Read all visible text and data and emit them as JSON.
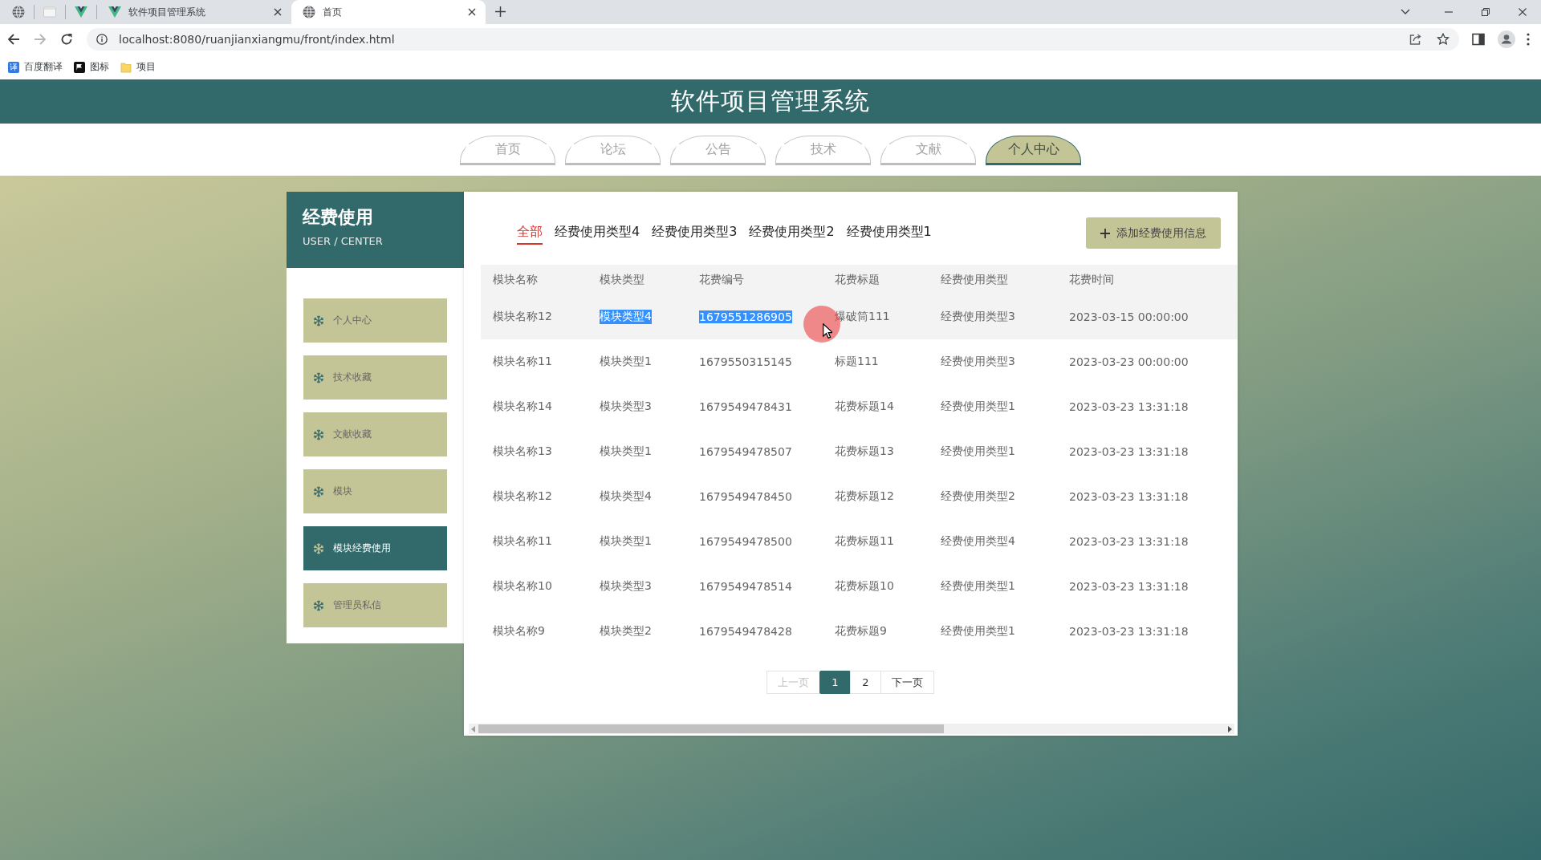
{
  "browser": {
    "tabs": [
      {
        "kind": "globe",
        "selected": false
      },
      {
        "kind": "page",
        "selected": false
      },
      {
        "kind": "v-logo",
        "selected": false
      },
      {
        "kind": "v-logo",
        "title": "软件项目管理系统",
        "selected": false
      },
      {
        "kind": "globe",
        "title": "首页",
        "selected": true
      }
    ],
    "address_bar": {
      "url": "localhost:8080/ruanjianxiangmu/front/index.html",
      "forward_enabled": false
    },
    "bookmarks": [
      {
        "kind": "translate",
        "badge": "译",
        "label": "百度翻译"
      },
      {
        "kind": "flag",
        "label": "图标"
      },
      {
        "kind": "folder",
        "label": "项目"
      }
    ]
  },
  "site_title": "软件项目管理系统",
  "nav": [
    {
      "label": "首页",
      "selected": false
    },
    {
      "label": "论坛",
      "selected": false
    },
    {
      "label": "公告",
      "selected": false
    },
    {
      "label": "技术",
      "selected": false
    },
    {
      "label": "文献",
      "selected": false
    },
    {
      "label": "个人中心",
      "selected": true
    }
  ],
  "sidebar": {
    "title": "经费使用",
    "subtitle": "USER / CENTER",
    "items": [
      {
        "label": "个人中心",
        "selected": false
      },
      {
        "label": "技术收藏",
        "selected": false
      },
      {
        "label": "文献收藏",
        "selected": false
      },
      {
        "label": "模块",
        "selected": false
      },
      {
        "label": "模块经费使用",
        "selected": true
      },
      {
        "label": "管理员私信",
        "selected": false
      }
    ]
  },
  "filters": [
    {
      "label": "全部",
      "selected": true
    },
    {
      "label": "经费使用类型4",
      "selected": false
    },
    {
      "label": "经费使用类型3",
      "selected": false
    },
    {
      "label": "经费使用类型2",
      "selected": false
    },
    {
      "label": "经费使用类型1",
      "selected": false
    }
  ],
  "add_button": {
    "label": "添加经费使用信息"
  },
  "table": {
    "columns": [
      "模块名称",
      "模块类型",
      "花费编号",
      "花费标题",
      "经费使用类型",
      "花费时间"
    ],
    "rows": [
      {
        "hovered": true,
        "cells": [
          "模块名称12",
          "模块类型4",
          "1679551286905",
          "爆破筒111",
          "经费使用类型3",
          "2023-03-15 00:00:00"
        ],
        "text_selected": [
          false,
          true,
          true,
          false,
          false,
          false
        ]
      },
      {
        "hovered": false,
        "cells": [
          "模块名称11",
          "模块类型1",
          "1679550315145",
          "标题111",
          "经费使用类型3",
          "2023-03-23 00:00:00"
        ],
        "text_selected": [
          false,
          false,
          false,
          false,
          false,
          false
        ]
      },
      {
        "hovered": false,
        "cells": [
          "模块名称14",
          "模块类型3",
          "1679549478431",
          "花费标题14",
          "经费使用类型1",
          "2023-03-23 13:31:18"
        ],
        "text_selected": [
          false,
          false,
          false,
          false,
          false,
          false
        ]
      },
      {
        "hovered": false,
        "cells": [
          "模块名称13",
          "模块类型1",
          "1679549478507",
          "花费标题13",
          "经费使用类型1",
          "2023-03-23 13:31:18"
        ],
        "text_selected": [
          false,
          false,
          false,
          false,
          false,
          false
        ]
      },
      {
        "hovered": false,
        "cells": [
          "模块名称12",
          "模块类型4",
          "1679549478450",
          "花费标题12",
          "经费使用类型2",
          "2023-03-23 13:31:18"
        ],
        "text_selected": [
          false,
          false,
          false,
          false,
          false,
          false
        ]
      },
      {
        "hovered": false,
        "cells": [
          "模块名称11",
          "模块类型1",
          "1679549478500",
          "花费标题11",
          "经费使用类型4",
          "2023-03-23 13:31:18"
        ],
        "text_selected": [
          false,
          false,
          false,
          false,
          false,
          false
        ]
      },
      {
        "hovered": false,
        "cells": [
          "模块名称10",
          "模块类型3",
          "1679549478514",
          "花费标题10",
          "经费使用类型1",
          "2023-03-23 13:31:18"
        ],
        "text_selected": [
          false,
          false,
          false,
          false,
          false,
          false
        ]
      },
      {
        "hovered": false,
        "cells": [
          "模块名称9",
          "模块类型2",
          "1679549478428",
          "花费标题9",
          "经费使用类型1",
          "2023-03-23 13:31:18"
        ],
        "text_selected": [
          false,
          false,
          false,
          false,
          false,
          false
        ]
      }
    ]
  },
  "pagination": {
    "prev": {
      "label": "上一页",
      "disabled": true
    },
    "pages": [
      {
        "label": "1",
        "selected": true
      },
      {
        "label": "2",
        "selected": false
      }
    ],
    "next": {
      "label": "下一页",
      "disabled": false
    }
  },
  "pointer": {
    "click_ring": true
  }
}
